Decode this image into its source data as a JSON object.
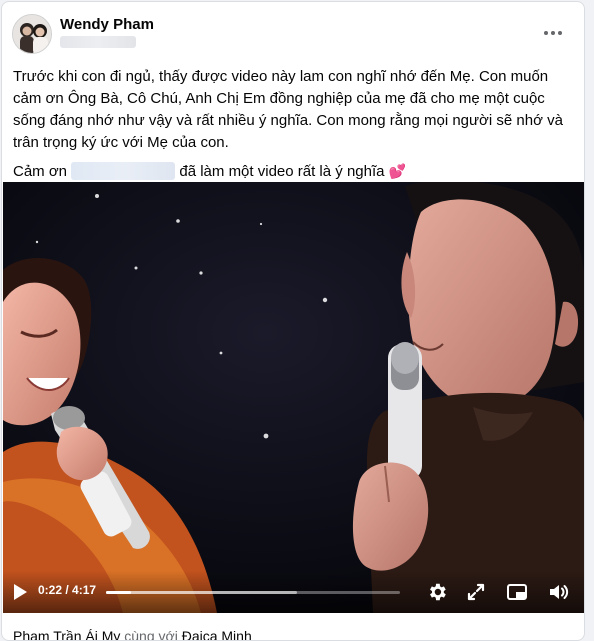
{
  "post": {
    "author": "Wendy Pham",
    "menu_icon": "more-horizontal-icon",
    "paragraphs": [
      "Trước khi con đi ngủ, thấy được video này lam con nghĩ nhớ đến Mẹ. Con muốn cảm ơn Ông Bà, Cô Chú, Anh Chị Em đồng nghiệp của mẹ đã cho mẹ một cuộc sống đáng nhớ như vậy và rất nhiều ý nghĩa. Con mong rằng mọi người sẽ nhớ và trân trọng ký ức với Mẹ của con."
    ],
    "thanks_prefix": "Cảm ơn",
    "thanks_suffix": "đã làm một video rất là ý nghĩa",
    "heart_emoji": "💕"
  },
  "video": {
    "current_time": "0:22",
    "duration": "4:17",
    "time_display": "0:22 / 4:17",
    "progress_fraction": 0.0856,
    "buffered_fraction": 0.65,
    "controls": {
      "play_icon": "play-icon",
      "settings_icon": "gear-icon",
      "fullscreen_icon": "expand-icon",
      "pip_icon": "picture-in-picture-icon",
      "volume_icon": "volume-icon"
    }
  },
  "footer": {
    "name": "Phạm Trần Ái My",
    "with_text": "cùng với",
    "tagged": "Đaica Minh"
  },
  "colors": {
    "text": "#050505",
    "secondary": "#65676b",
    "heart": "#e0245e",
    "video_bg": "#05060c"
  }
}
